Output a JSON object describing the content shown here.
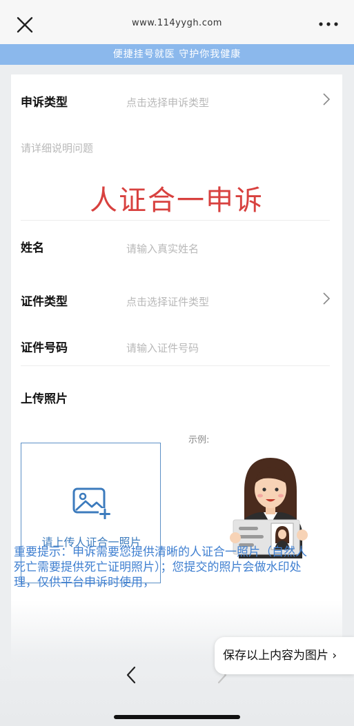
{
  "browser": {
    "url": "www.114yygh.com"
  },
  "banner": {
    "text": "便捷挂号就医 守护你我健康"
  },
  "form": {
    "complaint_type_label": "申诉类型",
    "complaint_type_placeholder": "点击选择申诉类型",
    "description_placeholder": "请详细说明问题",
    "headline": "人证合一申诉",
    "name_label": "姓名",
    "name_placeholder": "请输入真实姓名",
    "id_type_label": "证件类型",
    "id_type_placeholder": "点击选择证件类型",
    "id_number_label": "证件号码",
    "id_number_placeholder": "请输入证件号码",
    "upload_label": "上传照片",
    "example_label": "示例:",
    "upload_text": "请上传人证合一照片"
  },
  "notice": {
    "text": "重要提示：申诉需要您提供清晰的人证合一照片（自然人死亡需要提供死亡证明照片）；您提交的照片会做水印处理，仅供平台申诉时使用，"
  },
  "actions": {
    "save_image": "保存以上内容为图片 ›"
  },
  "colors": {
    "banner": "#8bb8ec",
    "accent_red": "#d8413f",
    "link_blue": "#3c7bbd"
  }
}
